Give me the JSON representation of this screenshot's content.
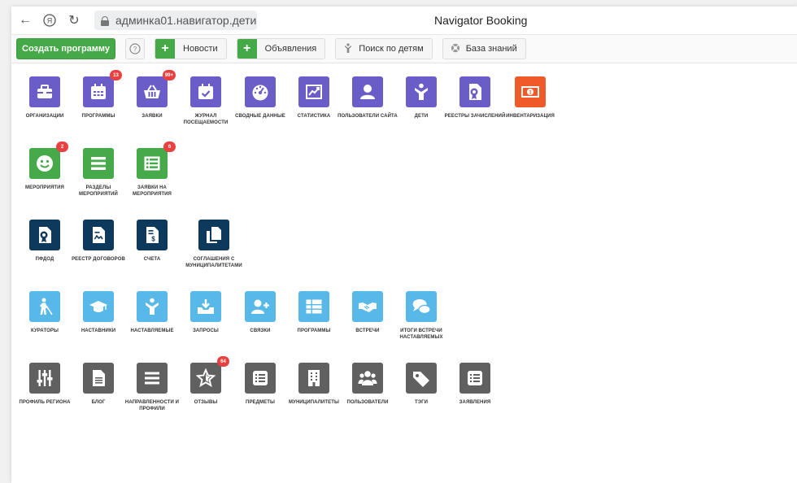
{
  "browser": {
    "url": "админка01.навигатор.дети",
    "title": "Navigator Booking"
  },
  "toolbar": {
    "create_program": "Создать программу",
    "news": "Новости",
    "announcements": "Объявления",
    "child_search": "Поиск по детям",
    "knowledge_base": "База знаний"
  },
  "tiles": [
    {
      "label": "ОРГАНИЗАЦИИ",
      "icon": "briefcase-icon",
      "color": "#6b5dc8",
      "badge": ""
    },
    {
      "label": "ПРОГРАММЫ",
      "icon": "calendar-icon",
      "color": "#6b5dc8",
      "badge": "13"
    },
    {
      "label": "ЗАЯВКИ",
      "icon": "basket-icon",
      "color": "#6b5dc8",
      "badge": "99+"
    },
    {
      "label": "ЖУРНАЛ ПОСЕЩАЕМОСТИ",
      "icon": "calendar-check-icon",
      "color": "#6b5dc8",
      "badge": ""
    },
    {
      "label": "СВОДНЫЕ ДАННЫЕ",
      "icon": "dashboard-icon",
      "color": "#6b5dc8",
      "badge": ""
    },
    {
      "label": "СТАТИСТИКА",
      "icon": "chart-icon",
      "color": "#6b5dc8",
      "badge": ""
    },
    {
      "label": "ПОЛЬЗОВАТЕЛИ САЙТА",
      "icon": "user-icon",
      "color": "#6b5dc8",
      "badge": ""
    },
    {
      "label": "ДЕТИ",
      "icon": "child-icon",
      "color": "#6b5dc8",
      "badge": ""
    },
    {
      "label": "РЕЕСТРЫ ЗАЧИСЛЕНИЙ",
      "icon": "certificate-icon",
      "color": "#6b5dc8",
      "badge": ""
    },
    {
      "label": "ИНВЕНТАРИЗАЦИЯ",
      "icon": "money-icon",
      "color": "#f05a28",
      "badge": ""
    },
    {
      "label": "МЕРОПРИЯТИЯ",
      "icon": "smile-icon",
      "color": "#46a94a",
      "badge": "2"
    },
    {
      "label": "РАЗДЕЛЫ МЕРОПРИЯТИЙ",
      "icon": "list-icon",
      "color": "#46a94a",
      "badge": ""
    },
    {
      "label": "ЗАЯВКИ НА МЕРОПРИЯТИЯ",
      "icon": "list-bullets-icon",
      "color": "#46a94a",
      "badge": "6"
    },
    {
      "label": "ПФДОД",
      "icon": "certificate-icon",
      "color": "#0d3a5c",
      "badge": ""
    },
    {
      "label": "РЕЕСТР ДОГОВОРОВ",
      "icon": "contract-icon",
      "color": "#0d3a5c",
      "badge": ""
    },
    {
      "label": "СЧЕТА",
      "icon": "invoice-icon",
      "color": "#0d3a5c",
      "badge": ""
    },
    {
      "label": "СОГЛАШЕНИЯ С МУНИЦИПАЛИТЕТАМИ",
      "icon": "copy-icon",
      "color": "#0d3a5c",
      "badge": ""
    },
    {
      "label": "КУРАТОРЫ",
      "icon": "blind-icon",
      "color": "#58b8e8",
      "badge": ""
    },
    {
      "label": "НАСТАВНИКИ",
      "icon": "graduation-cap-icon",
      "color": "#58b8e8",
      "badge": ""
    },
    {
      "label": "НАСТАВЛЯЕМЫЕ",
      "icon": "child-icon",
      "color": "#58b8e8",
      "badge": ""
    },
    {
      "label": "ЗАПРОСЫ",
      "icon": "inbox-download-icon",
      "color": "#58b8e8",
      "badge": ""
    },
    {
      "label": "СВЯЗКИ",
      "icon": "user-plus-icon",
      "color": "#58b8e8",
      "badge": ""
    },
    {
      "label": "ПРОГРАММЫ",
      "icon": "table-list-icon",
      "color": "#58b8e8",
      "badge": ""
    },
    {
      "label": "ВСТРЕЧИ",
      "icon": "handshake-icon",
      "color": "#58b8e8",
      "badge": ""
    },
    {
      "label": "ИТОГИ ВСТРЕЧИ НАСТАВЛЯЕМЫХ",
      "icon": "comments-icon",
      "color": "#58b8e8",
      "badge": ""
    },
    {
      "label": "ПРОФИЛЬ РЕГИОНА",
      "icon": "sliders-icon",
      "color": "#606060",
      "badge": ""
    },
    {
      "label": "БЛОГ",
      "icon": "document-icon",
      "color": "#606060",
      "badge": ""
    },
    {
      "label": "НАПРАВЛЕННОСТИ И ПРОФИЛИ",
      "icon": "menu-icon",
      "color": "#606060",
      "badge": ""
    },
    {
      "label": "ОТЗЫВЫ",
      "icon": "star-icon",
      "color": "#606060",
      "badge": "64"
    },
    {
      "label": "ПРЕДМЕТЫ",
      "icon": "list-box-icon",
      "color": "#606060",
      "badge": ""
    },
    {
      "label": "МУНИЦИПАЛИТЕТЫ",
      "icon": "building-icon",
      "color": "#606060",
      "badge": ""
    },
    {
      "label": "ПОЛЬЗОВАТЕЛИ",
      "icon": "users-icon",
      "color": "#606060",
      "badge": ""
    },
    {
      "label": "ТЭГИ",
      "icon": "tags-icon",
      "color": "#606060",
      "badge": ""
    },
    {
      "label": "ЗАЯВЛЕНИЯ",
      "icon": "list-box-icon",
      "color": "#606060",
      "badge": ""
    }
  ]
}
